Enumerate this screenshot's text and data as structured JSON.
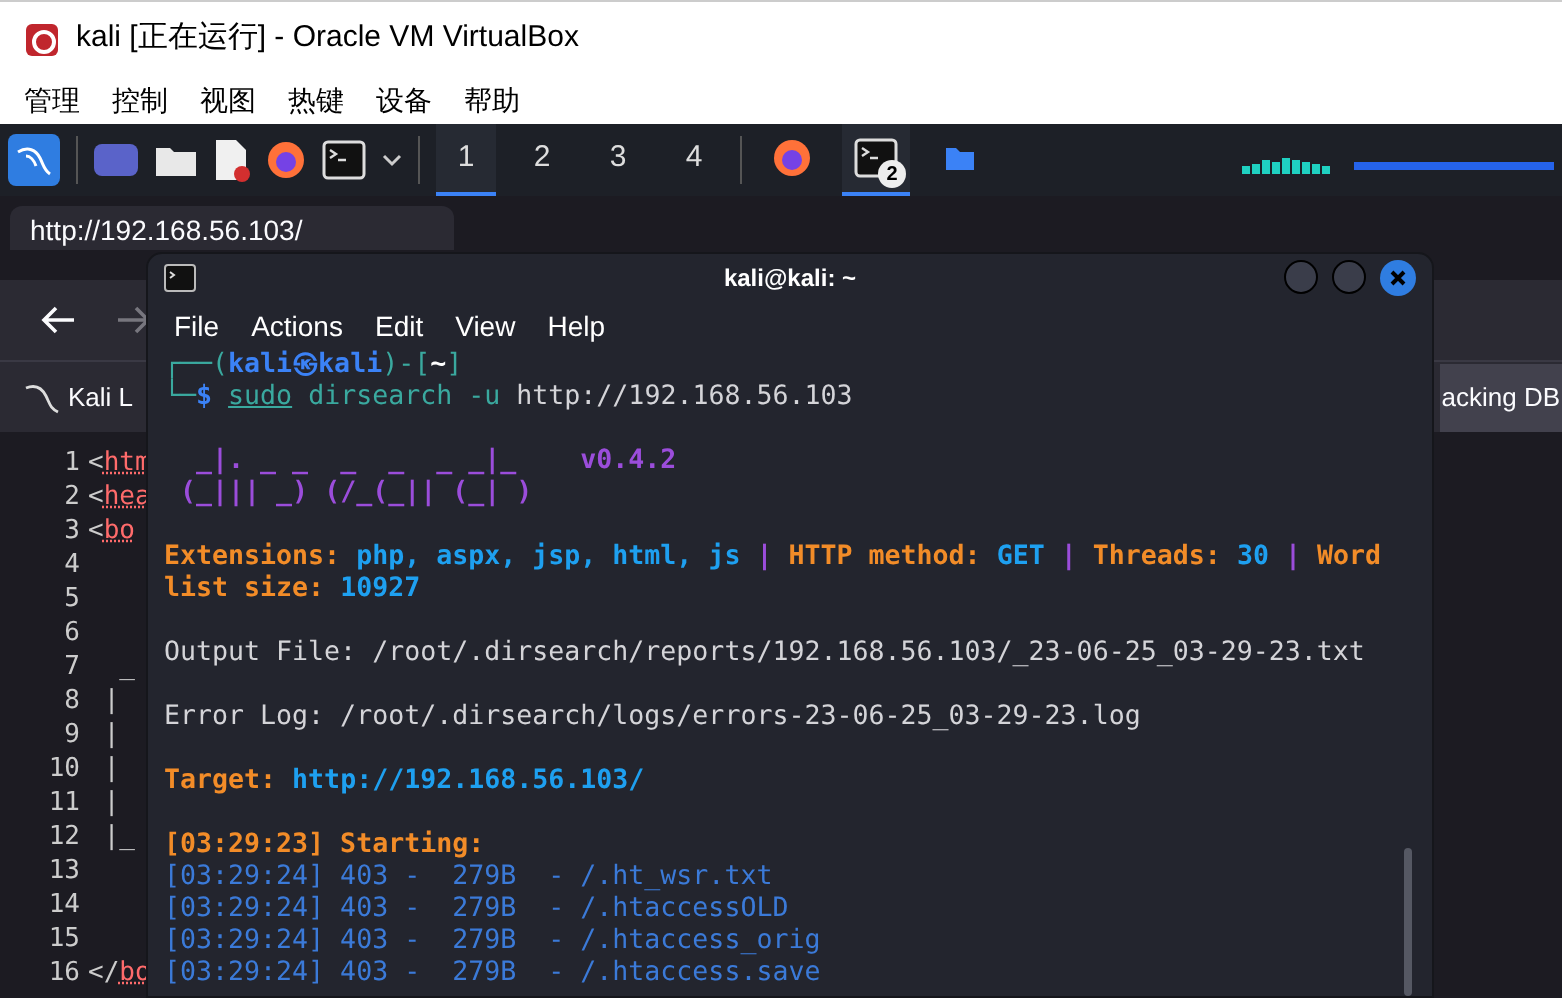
{
  "window": {
    "title": "kali [正在运行] - Oracle VM VirtualBox"
  },
  "menu": [
    "管理",
    "控制",
    "视图",
    "热键",
    "设备",
    "帮助"
  ],
  "taskbar": {
    "workspaces": [
      {
        "label": "1",
        "selected": true
      },
      {
        "label": "2",
        "selected": false
      },
      {
        "label": "3",
        "selected": false
      },
      {
        "label": "4",
        "selected": false
      }
    ],
    "tasks": [
      {
        "kind": "browser",
        "selected": false
      },
      {
        "kind": "terminal",
        "selected": true,
        "badge": "2"
      },
      {
        "kind": "folder",
        "selected": false
      }
    ]
  },
  "browser": {
    "tab": {
      "title": "http://192.168.56.103/"
    },
    "bookmarks": [
      {
        "label": "Kali L",
        "highlighted": false
      },
      {
        "label": "acking DB",
        "highlighted": true
      }
    ],
    "source_lines": [
      {
        "number": "1",
        "kind": "tag",
        "open": "<",
        "tag": "htm"
      },
      {
        "number": "2",
        "kind": "tag",
        "open": "<",
        "tag": "hea"
      },
      {
        "number": "3",
        "kind": "tag",
        "open": "<",
        "tag": "bo"
      },
      {
        "number": "4"
      },
      {
        "number": "5"
      },
      {
        "number": "6"
      },
      {
        "number": "7",
        "kind": "art",
        "text": "  _"
      },
      {
        "number": "8",
        "kind": "art",
        "text": " |"
      },
      {
        "number": "9",
        "kind": "art",
        "text": " |"
      },
      {
        "number": "10",
        "kind": "art",
        "text": " |"
      },
      {
        "number": "11",
        "kind": "art",
        "text": " |"
      },
      {
        "number": "12",
        "kind": "art",
        "text": " |_"
      },
      {
        "number": "13"
      },
      {
        "number": "14"
      },
      {
        "number": "15"
      },
      {
        "number": "16",
        "kind": "tag",
        "open": "</",
        "tag": "bo"
      }
    ]
  },
  "terminal": {
    "title": "kali@kali: ~",
    "menu": [
      "File",
      "Actions",
      "Edit",
      "View",
      "Help"
    ],
    "blocks": [
      [
        [
          {
            "kind": "frame",
            "text": "┌──("
          },
          {
            "kind": "user",
            "text": "kali㉿kali"
          },
          {
            "kind": "frame",
            "text": ")-["
          },
          {
            "kind": "path",
            "text": "~"
          },
          {
            "kind": "frame",
            "text": "]"
          }
        ],
        [
          {
            "kind": "frame",
            "text": "└─"
          },
          {
            "kind": "user",
            "text": "$ "
          },
          {
            "kind": "sudo",
            "text": "sudo"
          },
          {
            "kind": "cmd",
            "text": " dirsearch -u"
          },
          {
            "kind": "plain",
            "text": " http://192.168.56.103"
          }
        ]
      ],
      [
        [
          {
            "kind": "banner",
            "text": "  _|. _ _  _  _  _ _|_    "
          },
          {
            "kind": "version",
            "text": "v0.4.2"
          }
        ],
        [
          {
            "kind": "banner",
            "text": " (_||| _) (/_(_|| (_| )"
          }
        ]
      ],
      [
        [
          {
            "kind": "label",
            "text": "Extensions: "
          },
          {
            "kind": "value",
            "text": "php, aspx, jsp, html, js"
          },
          {
            "kind": "sep",
            "text": " | "
          },
          {
            "kind": "label",
            "text": "HTTP method: "
          },
          {
            "kind": "value",
            "text": "GET"
          },
          {
            "kind": "sep",
            "text": " | "
          },
          {
            "kind": "label",
            "text": "Threads: "
          },
          {
            "kind": "value",
            "text": "30"
          },
          {
            "kind": "sep",
            "text": " | "
          },
          {
            "kind": "label",
            "text": "Wordlist size: "
          },
          {
            "kind": "value",
            "text": "10927"
          }
        ]
      ],
      [
        [
          {
            "kind": "plain",
            "text": "Output File: /root/.dirsearch/reports/192.168.56.103/_23-06-25_03-29-23.txt"
          }
        ]
      ],
      [
        [
          {
            "kind": "plain",
            "text": "Error Log: /root/.dirsearch/logs/errors-23-06-25_03-29-23.log"
          }
        ]
      ],
      [
        [
          {
            "kind": "label",
            "text": "Target: "
          },
          {
            "kind": "value",
            "text": "http://192.168.56.103/"
          }
        ]
      ],
      [
        [
          {
            "kind": "label",
            "text": "[03:29:23] Starting:"
          }
        ],
        [
          {
            "kind": "result",
            "text": "[03:29:24] 403 -  279B  - /.ht_wsr.txt"
          }
        ],
        [
          {
            "kind": "result",
            "text": "[03:29:24] 403 -  279B  - /.htaccessOLD"
          }
        ],
        [
          {
            "kind": "result",
            "text": "[03:29:24] 403 -  279B  - /.htaccess_orig"
          }
        ],
        [
          {
            "kind": "result",
            "text": "[03:29:24] 403 -  279B  - /.htaccess.save"
          }
        ]
      ]
    ]
  }
}
